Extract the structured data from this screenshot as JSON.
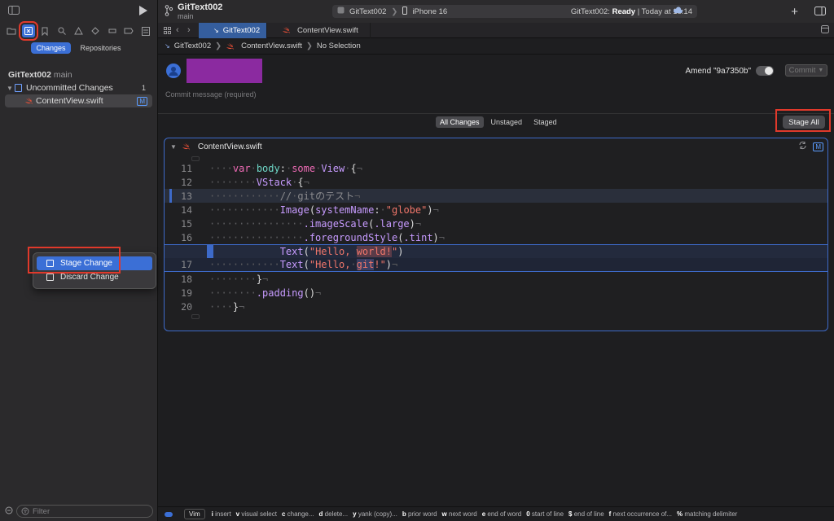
{
  "window": {
    "project": "GitText002",
    "branch": "main",
    "scheme_project": "GitText002",
    "scheme_device": "iPhone 16",
    "status_project": "GitText002:",
    "status_state": "Ready",
    "status_time": "Today at 18:14"
  },
  "sidebar": {
    "segments": [
      "Changes",
      "Repositories"
    ],
    "project_name": "GitText002",
    "project_branch": "main",
    "group_label": "Uncommitted Changes",
    "group_count": "1",
    "file_name": "ContentView.swift",
    "file_badge": "M",
    "filter_placeholder": "Filter"
  },
  "context_menu": {
    "items": [
      "Stage Change",
      "Discard Change"
    ]
  },
  "tabs": [
    "GitText002",
    "ContentView.swift"
  ],
  "jumpbar": [
    "GitText002",
    "ContentView.swift",
    "No Selection"
  ],
  "commit": {
    "message_placeholder": "Commit message (required)",
    "amend_label": "Amend \"9a7350b\"",
    "commit_button": "Commit"
  },
  "filters": {
    "items": [
      "All Changes",
      "Unstaged",
      "Staged"
    ],
    "stage_all": "Stage All"
  },
  "diff": {
    "file_name": "ContentView.swift",
    "badge": "M",
    "lines": [
      {
        "num": "11"
      },
      {
        "num": "12"
      },
      {
        "num": "13"
      },
      {
        "num": "14"
      },
      {
        "num": "15"
      },
      {
        "num": "16"
      },
      {
        "num": ""
      },
      {
        "num": "17"
      },
      {
        "num": "18"
      },
      {
        "num": "19"
      },
      {
        "num": "20"
      }
    ]
  },
  "statusbar": {
    "mode": "Vim",
    "hints": [
      {
        "key": "i",
        "text": "insert"
      },
      {
        "key": "v",
        "text": "visual select"
      },
      {
        "key": "c",
        "text": "change..."
      },
      {
        "key": "d",
        "text": "delete..."
      },
      {
        "key": "y",
        "text": "yank (copy)..."
      },
      {
        "key": "b",
        "text": "prior word"
      },
      {
        "key": "w",
        "text": "next word"
      },
      {
        "key": "e",
        "text": "end of word"
      },
      {
        "key": "0",
        "text": "start of line"
      },
      {
        "key": "$",
        "text": "end of line"
      },
      {
        "key": "f",
        "text": "next occurrence of..."
      },
      {
        "key": "%",
        "text": "matching delimiter"
      }
    ]
  },
  "colors": {
    "accent": "#3b6fd6",
    "highlight_box": "#e0392b",
    "redaction": "#8b2aa0"
  }
}
